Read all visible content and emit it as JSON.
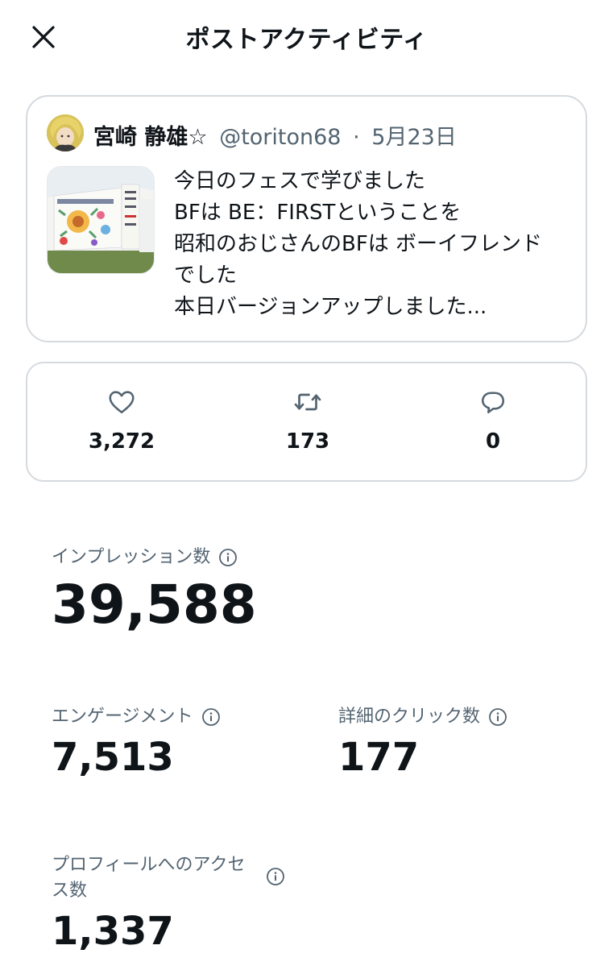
{
  "header": {
    "title": "ポストアクティビティ",
    "close_icon": "close-icon"
  },
  "post": {
    "author_name": "宮崎 静雄☆",
    "handle": "@toriton68",
    "separator": "·",
    "date": "5月23日",
    "lines": [
      "今日のフェスで学びました",
      "BFは BE：FIRSTということを",
      "昭和のおじさんのBFは ボーイフレンド",
      "でした",
      "本日バージョンアップしました..."
    ]
  },
  "metrics": {
    "likes": "3,272",
    "reposts": "173",
    "replies": "0",
    "icons": [
      "heart-icon",
      "repost-icon",
      "reply-icon"
    ]
  },
  "stats": {
    "impressions_label": "インプレッション数",
    "impressions_value": "39,588",
    "engagements_label": "エンゲージメント",
    "engagements_value": "7,513",
    "detail_clicks_label": "詳細のクリック数",
    "detail_clicks_value": "177",
    "profile_visits_label": "プロフィールへのアクセス数",
    "profile_visits_value": "1,337"
  },
  "colors": {
    "text_primary": "#0f1419",
    "text_secondary": "#536471",
    "border": "#d5dadf"
  }
}
